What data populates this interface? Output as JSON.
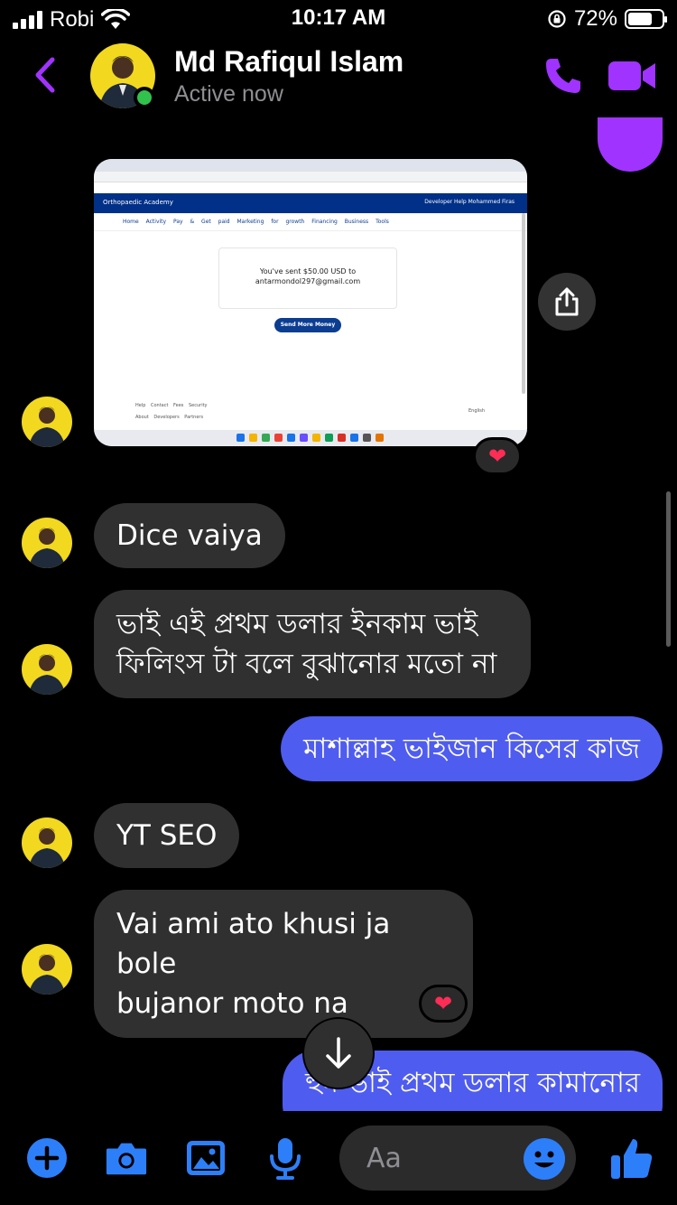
{
  "status_bar": {
    "carrier": "Robi",
    "time": "10:17 AM",
    "battery_percent": "72%",
    "battery_level": 0.72
  },
  "header": {
    "contact_name": "Md Rafiqul Islam",
    "contact_status": "Active now",
    "icons": [
      "back-chevron-icon",
      "phone-icon",
      "video-camera-icon"
    ],
    "accent_color": "#a033ff"
  },
  "shared_image": {
    "pp_brand": "Orthopaedic Academy",
    "pp_top_right": "Developer   Help   Mohammed Firas",
    "pp_nav": "Home Activity Pay & Get paid Marketing for growth Financing Business Tools",
    "sent_line1": "You've sent $50.00 USD to",
    "sent_line2": "antarmondol297@gmail.com",
    "send_more_button": "Send More Money",
    "footer_row1": "Help Contact Fees Security",
    "footer_row2": "About Developers Partners",
    "language": "English"
  },
  "messages": [
    {
      "id": "m1",
      "direction": "incoming",
      "text": "Dice vaiya"
    },
    {
      "id": "m2",
      "direction": "incoming",
      "text": "ভাই এই প্রথম ডলার ইনকাম ভাই\nফিলিংস টা বলে বুঝানোর মতো না"
    },
    {
      "id": "m3",
      "direction": "outgoing",
      "text": "মাশাল্লাহ ভাইজান কিসের কাজ"
    },
    {
      "id": "m4",
      "direction": "incoming",
      "text": "YT SEO"
    },
    {
      "id": "m5",
      "direction": "incoming",
      "text": "Vai ami ato khusi ja bole\nbujanor moto na"
    },
    {
      "id": "m6",
      "direction": "outgoing",
      "text": "হুম ভাই প্রথম ডলার কামানোর"
    }
  ],
  "reactions": {
    "image": "❤",
    "m5": "❤"
  },
  "composer": {
    "placeholder": "Aa",
    "icons": [
      "plus-icon",
      "camera-icon",
      "gallery-icon",
      "microphone-icon",
      "emoji-icon",
      "thumbs-up-icon"
    ],
    "accent_color": "#2d7ff9"
  },
  "bubble_colors": {
    "incoming": "#303030",
    "outgoing": "#4f5cf0"
  }
}
